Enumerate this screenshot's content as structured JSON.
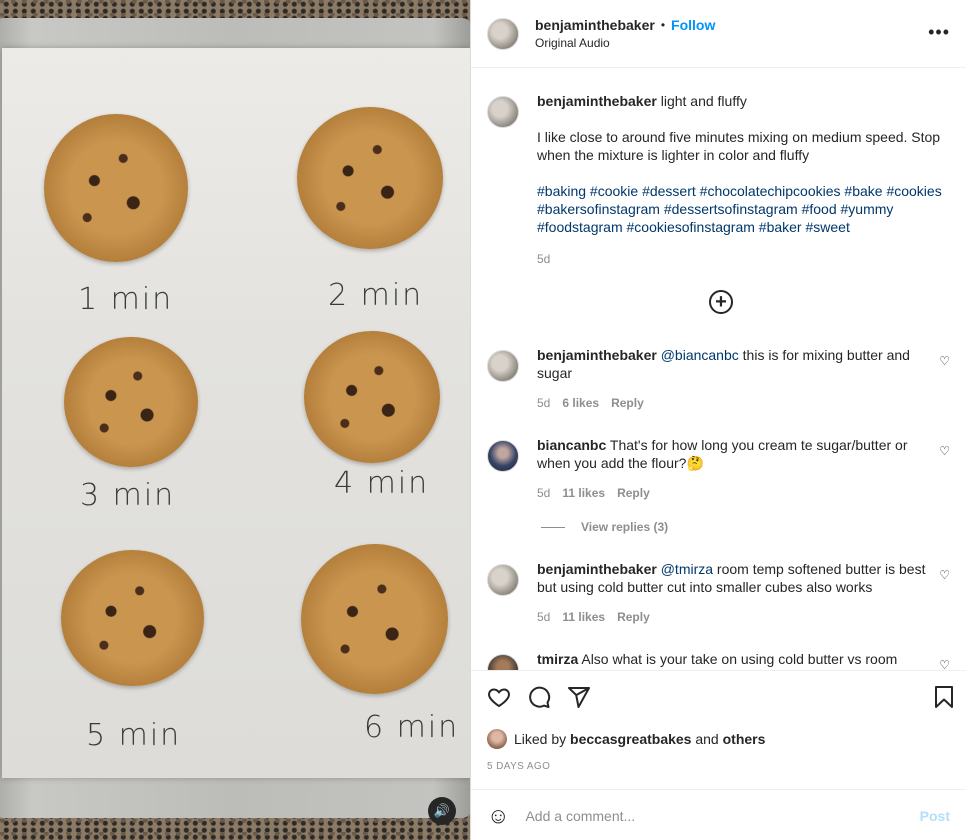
{
  "media": {
    "labels": [
      "1 min",
      "2 min",
      "3 min",
      "4 min",
      "5 min",
      "6 min"
    ],
    "audio_icon": "speaker-icon"
  },
  "header": {
    "username": "benjaminthebaker",
    "separator": "•",
    "follow_label": "Follow",
    "subtitle": "Original Audio",
    "more_icon": "more-options-icon"
  },
  "caption": {
    "username": "benjaminthebaker",
    "title": "light and fluffy",
    "text": "I like close to around five minutes mixing on medium speed. Stop when the mixture is lighter in color and fluffy",
    "hashtags": "#baking #cookie #dessert #chocolatechipcookies #bake #cookies #bakersofinstagram #dessertsofinstagram #food #yummy #foodstagram #cookiesofinstagram #baker #sweet",
    "time": "5d"
  },
  "comments": [
    {
      "username": "benjaminthebaker",
      "mention": "@biancanbc",
      "text": " this is for mixing butter and sugar",
      "time": "5d",
      "likes": "6 likes",
      "reply": "Reply"
    },
    {
      "username": "biancanbc",
      "mention": "",
      "text": " That's for how long you cream te sugar/butter or when you add the flour?🤔",
      "time": "5d",
      "likes": "11 likes",
      "reply": "Reply"
    },
    {
      "username": "benjaminthebaker",
      "mention": "@tmirza",
      "text": " room temp softened butter is best but using cold butter cut into smaller cubes also works",
      "time": "5d",
      "likes": "11 likes",
      "reply": "Reply"
    },
    {
      "username": "tmirza",
      "mention": "",
      "text": " Also what is your take on using cold butter vs room",
      "time": "",
      "likes": "",
      "reply": ""
    }
  ],
  "view_replies": "View replies (3)",
  "actions": {
    "liked_prefix": "Liked by ",
    "liked_user": "beccasgreatbakes",
    "liked_and": " and ",
    "liked_others": "others",
    "date": "5 DAYS AGO",
    "comment_placeholder": "Add a comment...",
    "post_label": "Post"
  }
}
